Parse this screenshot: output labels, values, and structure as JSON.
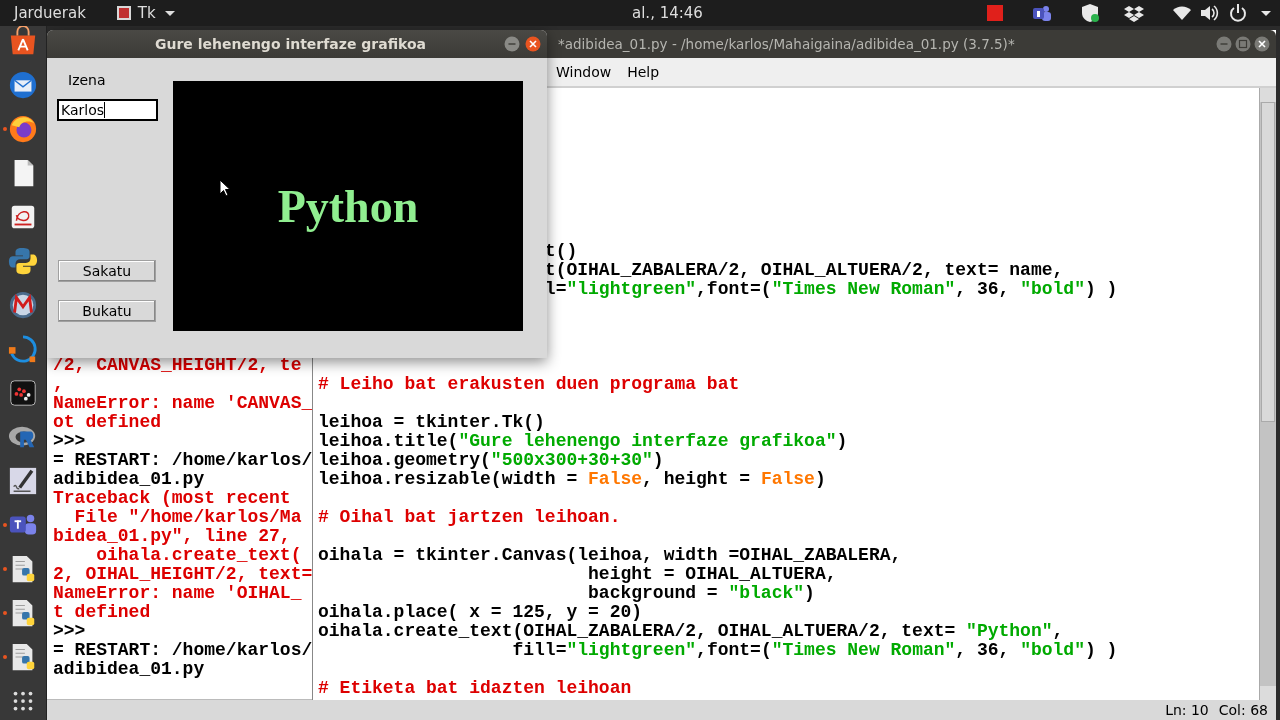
{
  "top_bar": {
    "activities": "Jarduerak",
    "app_menu": "Tk",
    "clock": "al., 14:46"
  },
  "dock": [
    {
      "running": false
    },
    {
      "running": false
    },
    {
      "running": true
    },
    {
      "running": false
    },
    {
      "running": false
    },
    {
      "running": false
    },
    {
      "running": false
    },
    {
      "running": false
    },
    {
      "running": false
    },
    {
      "running": false
    },
    {
      "running": false
    },
    {
      "running": true
    },
    {
      "running": true
    },
    {
      "running": true
    },
    {
      "running": true
    },
    {
      "running": false
    }
  ],
  "shell": {
    "lines": [
      {
        "kind": "error",
        "text": "/2, CANVAS_HEIGHT/2, te"
      },
      {
        "kind": "error",
        "text": ","
      },
      {
        "kind": "error",
        "text": "NameError: name 'CANVAS_"
      },
      {
        "kind": "error",
        "text": "ot defined"
      },
      {
        "kind": "output",
        "text": ">>>"
      },
      {
        "kind": "output",
        "text": "= RESTART: /home/karlos/"
      },
      {
        "kind": "output",
        "text": "adibidea_01.py"
      },
      {
        "kind": "error",
        "text": "Traceback (most recent"
      },
      {
        "kind": "error",
        "text": "  File \"/home/karlos/Ma"
      },
      {
        "kind": "error",
        "text": "bidea_01.py\", line 27,"
      },
      {
        "kind": "error",
        "text": "    oihala.create_text("
      },
      {
        "kind": "error",
        "text": "2, OIHAL_HEIGHT/2, text="
      },
      {
        "kind": "error",
        "text": "NameError: name 'OIHAL_"
      },
      {
        "kind": "error",
        "text": "t defined"
      },
      {
        "kind": "output",
        "text": ">>>"
      },
      {
        "kind": "output",
        "text": "= RESTART: /home/karlos/"
      },
      {
        "kind": "output",
        "text": "adibidea_01.py"
      }
    ]
  },
  "editor": {
    "title": "*adibidea_01.py - /home/karlos/Mahaigaina/adibidea_01.py (3.7.5)*",
    "menus": [
      "Window",
      "Help"
    ],
    "lines": [
      {
        "kind": "cut",
        "segments": [
          {
            "kind": "plain",
            "text": "t()"
          }
        ]
      },
      {
        "kind": "cut",
        "segments": [
          {
            "kind": "plain",
            "text": "t(OIHAL_ZABALERA/2, OIHAL_ALTUERA/2, text= name,"
          }
        ]
      },
      {
        "kind": "cut",
        "segments": [
          {
            "kind": "plain",
            "text": "l="
          },
          {
            "kind": "string",
            "text": "\"lightgreen\""
          },
          {
            "kind": "plain",
            "text": ",font=("
          },
          {
            "kind": "string",
            "text": "\"Times New Roman\""
          },
          {
            "kind": "plain",
            "text": ", 36, "
          },
          {
            "kind": "string",
            "text": "\"bold\""
          },
          {
            "kind": "plain",
            "text": ") )"
          }
        ]
      },
      {
        "kind": "blank"
      },
      {
        "kind": "blank"
      },
      {
        "kind": "blank"
      },
      {
        "kind": "blank"
      },
      {
        "kind": "code",
        "segments": [
          {
            "kind": "comment",
            "text": "# Leiho bat erakusten duen programa bat"
          }
        ]
      },
      {
        "kind": "blank"
      },
      {
        "kind": "code",
        "segments": [
          {
            "kind": "plain",
            "text": "leihoa = tkinter.Tk()"
          }
        ]
      },
      {
        "kind": "code",
        "segments": [
          {
            "kind": "plain",
            "text": "leihoa.title("
          },
          {
            "kind": "string",
            "text": "\"Gure lehenengo interfaze grafikoa\""
          },
          {
            "kind": "plain",
            "text": ")"
          }
        ]
      },
      {
        "kind": "code",
        "segments": [
          {
            "kind": "plain",
            "text": "leihoa.geometry("
          },
          {
            "kind": "string",
            "text": "\"500x300+30+30\""
          },
          {
            "kind": "plain",
            "text": ")"
          }
        ]
      },
      {
        "kind": "code",
        "segments": [
          {
            "kind": "plain",
            "text": "leihoa.resizable(width = "
          },
          {
            "kind": "keyword",
            "text": "False"
          },
          {
            "kind": "plain",
            "text": ", height = "
          },
          {
            "kind": "keyword",
            "text": "False"
          },
          {
            "kind": "plain",
            "text": ")"
          }
        ]
      },
      {
        "kind": "blank"
      },
      {
        "kind": "code",
        "segments": [
          {
            "kind": "comment",
            "text": "# Oihal bat jartzen leihoan."
          }
        ]
      },
      {
        "kind": "blank"
      },
      {
        "kind": "code",
        "segments": [
          {
            "kind": "plain",
            "text": "oihala = tkinter.Canvas(leihoa, width =OIHAL_ZABALERA,"
          }
        ]
      },
      {
        "kind": "code",
        "segments": [
          {
            "kind": "plain",
            "text": "                         height = OIHAL_ALTUERA,"
          }
        ]
      },
      {
        "kind": "code",
        "segments": [
          {
            "kind": "plain",
            "text": "                         background = "
          },
          {
            "kind": "string",
            "text": "\"black\""
          },
          {
            "kind": "plain",
            "text": ")"
          }
        ]
      },
      {
        "kind": "code",
        "segments": [
          {
            "kind": "plain",
            "text": "oihala.place( x = 125, y = 20)"
          }
        ]
      },
      {
        "kind": "code",
        "segments": [
          {
            "kind": "plain",
            "text": "oihala.create_text(OIHAL_ZABALERA/2, OIHAL_ALTUERA/2, text= "
          },
          {
            "kind": "string",
            "text": "\"Python\""
          },
          {
            "kind": "plain",
            "text": ","
          }
        ]
      },
      {
        "kind": "code",
        "segments": [
          {
            "kind": "plain",
            "text": "                  fill="
          },
          {
            "kind": "string",
            "text": "\"lightgreen\""
          },
          {
            "kind": "plain",
            "text": ",font=("
          },
          {
            "kind": "string",
            "text": "\"Times New Roman\""
          },
          {
            "kind": "plain",
            "text": ", 36, "
          },
          {
            "kind": "string",
            "text": "\"bold\""
          },
          {
            "kind": "plain",
            "text": ") )"
          }
        ]
      },
      {
        "kind": "blank"
      },
      {
        "kind": "code",
        "segments": [
          {
            "kind": "comment",
            "text": "# Etiketa bat idazten leihoan"
          }
        ]
      }
    ],
    "status": {
      "line": "Ln: 10",
      "column": "Col: 68"
    }
  },
  "tk_window": {
    "title": "Gure lehenengo interfaze grafikoa",
    "label": "Izena",
    "entry": {
      "value": "Karlos"
    },
    "buttons": [
      "Sakatu",
      "Bukatu"
    ],
    "canvas_text": "Python"
  }
}
